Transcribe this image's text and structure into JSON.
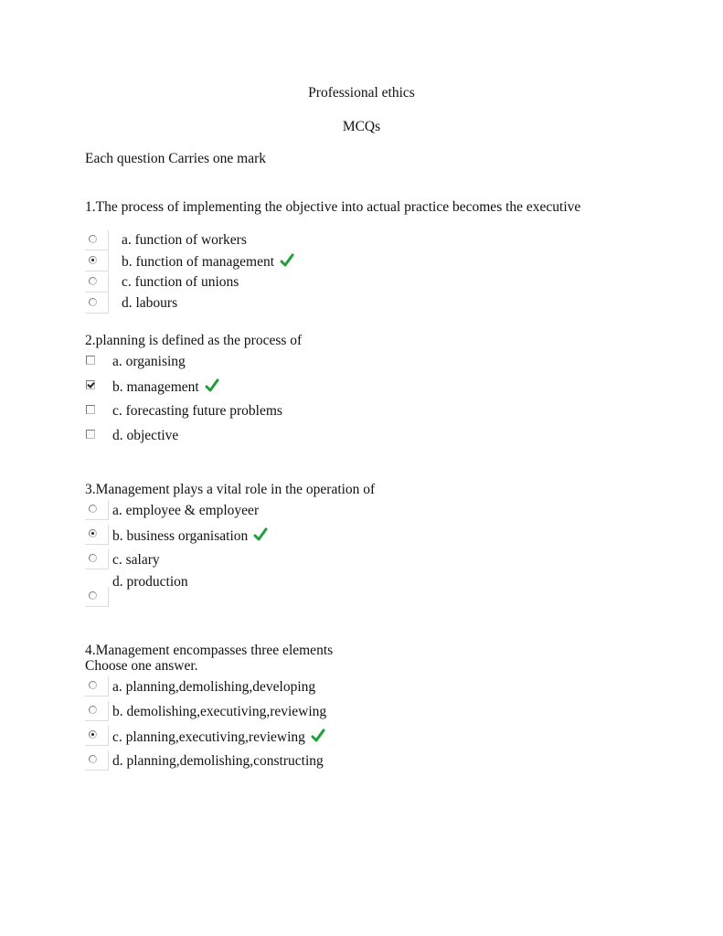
{
  "header": {
    "title": "Professional ethics",
    "subtitle": "MCQs",
    "instructions": "Each question Carries one mark"
  },
  "colors": {
    "correct_tick": "#1f9e3a"
  },
  "questions": [
    {
      "text": "1.The process of implementing the objective  into actual practice becomes the executive",
      "input_type": "radio",
      "options": [
        {
          "label": "a. function of workers",
          "selected": false,
          "correct": false
        },
        {
          "label": "b. function of management",
          "selected": true,
          "correct": true
        },
        {
          "label": "c. function of unions",
          "selected": false,
          "correct": false
        },
        {
          "label": "d. labours",
          "selected": false,
          "correct": false
        }
      ]
    },
    {
      "text": "2.planning is defined as the process of",
      "input_type": "checkbox",
      "options": [
        {
          "label": "a. organising",
          "selected": false,
          "correct": false
        },
        {
          "label": "b. management",
          "selected": true,
          "correct": true
        },
        {
          "label": "c. forecasting future problems",
          "selected": false,
          "correct": false
        },
        {
          "label": "d. objective",
          "selected": false,
          "correct": false
        }
      ]
    },
    {
      "text": "3.Management plays a vital role in the operation of",
      "input_type": "radio",
      "options": [
        {
          "label": "a. employee & employeer",
          "selected": false,
          "correct": false
        },
        {
          "label": "b. business organisation",
          "selected": true,
          "correct": true
        },
        {
          "label": "c. salary",
          "selected": false,
          "correct": false
        },
        {
          "label": "d. production",
          "selected": false,
          "correct": false
        }
      ]
    },
    {
      "text": "4.Management encompasses three elements",
      "subtext": "Choose one answer.",
      "input_type": "radio",
      "options": [
        {
          "label": "a. planning,demolishing,developing",
          "selected": false,
          "correct": false
        },
        {
          "label": "b. demolishing,executiving,reviewing",
          "selected": false,
          "correct": false
        },
        {
          "label": "c. planning,executiving,reviewing",
          "selected": true,
          "correct": true
        },
        {
          "label": "d. planning,demolishing,constructing",
          "selected": false,
          "correct": false
        }
      ]
    }
  ]
}
